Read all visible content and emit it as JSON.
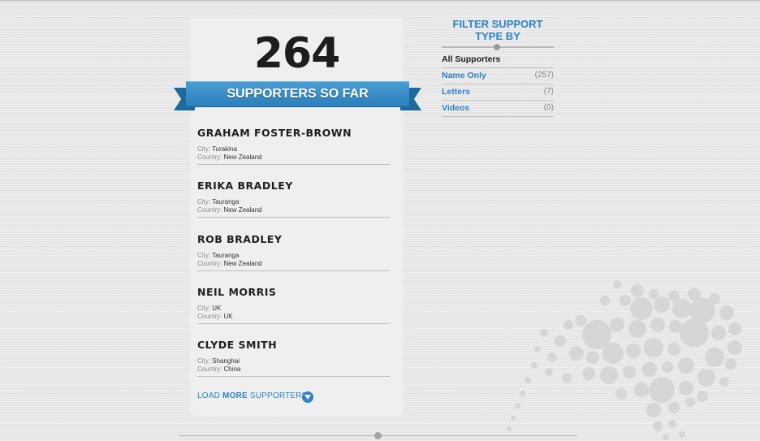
{
  "counter": {
    "value": "264",
    "label": "SUPPORTERS SO FAR"
  },
  "supporters": [
    {
      "name": "GRAHAM FOSTER-BROWN",
      "city_label": "City:",
      "city": "Turakina",
      "country_label": "Country:",
      "country": "New Zealand"
    },
    {
      "name": "ERIKA BRADLEY",
      "city_label": "City:",
      "city": "Tauranga",
      "country_label": "Country:",
      "country": "New Zealand"
    },
    {
      "name": "ROB BRADLEY",
      "city_label": "City:",
      "city": "Tauranga",
      "country_label": "Country:",
      "country": "New Zealand"
    },
    {
      "name": "NEIL MORRIS",
      "city_label": "City:",
      "city": "UK",
      "country_label": "Country:",
      "country": "UK"
    },
    {
      "name": "CLYDE SMITH",
      "city_label": "City:",
      "city": "Shanghai",
      "country_label": "Country:",
      "country": "China"
    }
  ],
  "load_more": {
    "prefix": "LOAD",
    "bold": "MORE",
    "suffix": "SUPPORTERS"
  },
  "filter": {
    "title_line1": "FILTER SUPPORT",
    "title_line2": "TYPE BY",
    "options": [
      {
        "label": "All Supporters",
        "count": ""
      },
      {
        "label": "Name Only",
        "count": "(257)"
      },
      {
        "label": "Letters",
        "count": "(7)"
      },
      {
        "label": "Videos",
        "count": "(0)"
      }
    ]
  },
  "colors": {
    "accent": "#2d83c4",
    "ribbon": "#2b7fbb"
  },
  "icons": {
    "load_more": "chevron-down-circle-icon",
    "decoration": "kiwi-bird-dots-icon"
  }
}
